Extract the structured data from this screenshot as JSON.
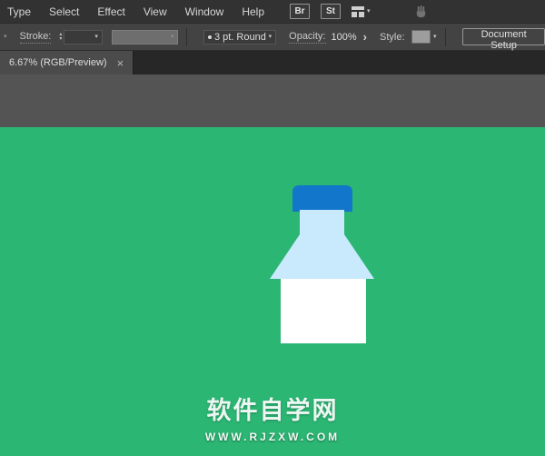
{
  "menu_bar": {
    "items": [
      "Type",
      "Select",
      "Effect",
      "View",
      "Window",
      "Help"
    ],
    "brushes_button": "Br",
    "styles_button": "St"
  },
  "control_bar": {
    "stroke_label": "Stroke:",
    "brush_stroke_value": "3 pt. Round",
    "opacity_label": "Opacity:",
    "opacity_value": "100%",
    "style_label": "Style:",
    "document_setup_button": "Document Setup"
  },
  "tab_bar": {
    "document_tab": "6.67% (RGB/Preview)",
    "close": "×"
  },
  "icons": {
    "chevron_down": "▾",
    "spinner_up": "▴",
    "spinner_down": "▾",
    "panel_arrow": "›"
  },
  "canvas": {
    "background_color": "#2bb673",
    "bottle": {
      "cap_color": "#1276cb",
      "glass_color": "#c9e9fc",
      "milk_color": "#ffffff"
    },
    "watermark": {
      "title": "软件自学网",
      "url": "WWW.RJZXW.COM"
    }
  }
}
